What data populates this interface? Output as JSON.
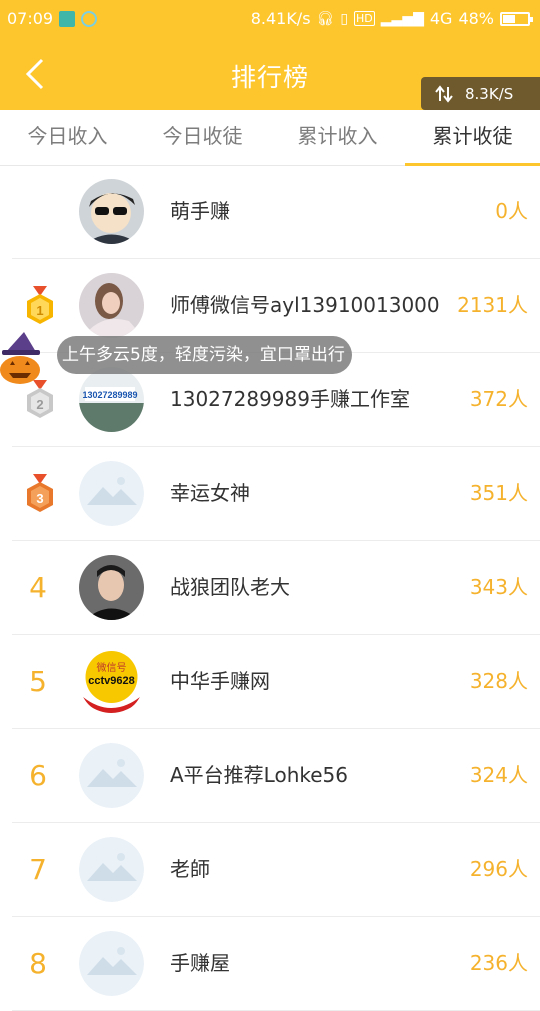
{
  "status_bar": {
    "time": "07:09",
    "net_speed": "8.41K/s",
    "hd": "HD",
    "network": "4G",
    "battery": "48%",
    "battery_level": 0.48
  },
  "header": {
    "title": "排行榜",
    "speed_badge": "8.3K/S"
  },
  "tabs": [
    {
      "label": "今日收入",
      "active": false
    },
    {
      "label": "今日收徒",
      "active": false
    },
    {
      "label": "累计收入",
      "active": false
    },
    {
      "label": "累计收徒",
      "active": true
    }
  ],
  "rows": [
    {
      "rank": "",
      "name": "萌手赚",
      "count": "0人",
      "avatar": "cartoon-avatar"
    },
    {
      "rank": "1",
      "name": "师傅微信号ayl13910013000",
      "count": "2131人",
      "avatar": "photo-avatar"
    },
    {
      "rank": "2",
      "name": "13027289989手赚工作室",
      "count": "372人",
      "avatar": "photo-avatar",
      "avatar_text": "13027289989"
    },
    {
      "rank": "3",
      "name": "幸运女神",
      "count": "351人",
      "avatar": "placeholder-avatar"
    },
    {
      "rank": "4",
      "name": "战狼团队老大",
      "count": "343人",
      "avatar": "photo-avatar"
    },
    {
      "rank": "5",
      "name": "中华手赚网",
      "count": "328人",
      "avatar": "logo-avatar",
      "avatar_text_1": "微信号",
      "avatar_text_2": "cctv9628"
    },
    {
      "rank": "6",
      "name": "A平台推荐Lohke56",
      "count": "324人",
      "avatar": "placeholder-avatar"
    },
    {
      "rank": "7",
      "name": "老師",
      "count": "296人",
      "avatar": "placeholder-avatar"
    },
    {
      "rank": "8",
      "name": "手赚屋",
      "count": "236人",
      "avatar": "placeholder-avatar"
    }
  ],
  "toast": {
    "text": "上午多云5度，轻度污染，宜口罩出行"
  },
  "colors": {
    "brand": "#fec62d",
    "rank_text": "#f5b22d",
    "gold": "#f7b500",
    "silver": "#c8c8c8",
    "bronze": "#e8782c"
  }
}
